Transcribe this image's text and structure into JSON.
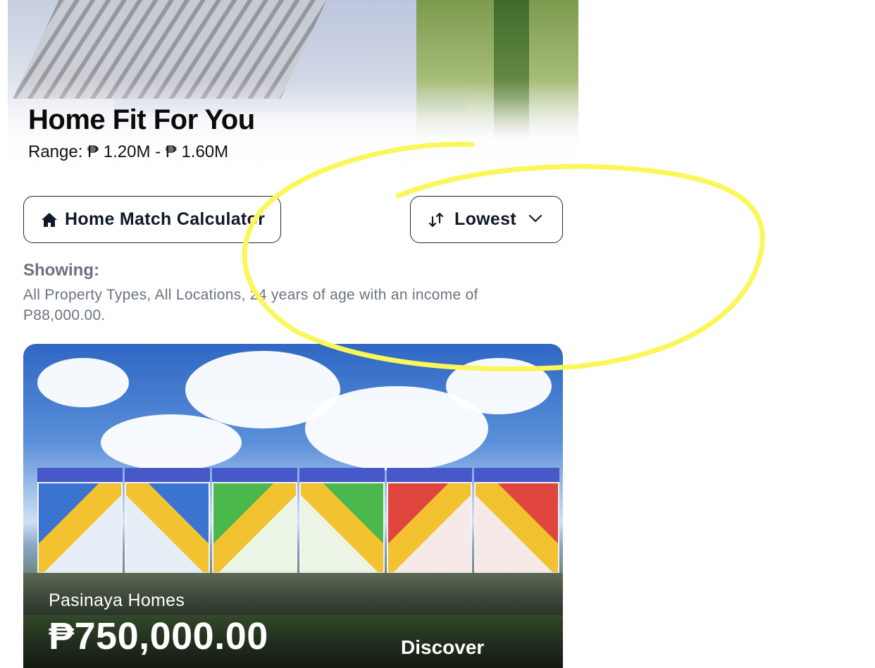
{
  "hero": {
    "title": "Home Fit For You",
    "range": "Range: ₱ 1.20M - ₱ 1.60M"
  },
  "toolbar": {
    "calculator_label": "Home Match Calculator",
    "sort_label": "Lowest",
    "icons": [
      "home-icon",
      "sort-arrows-icon",
      "chevron-down-icon"
    ]
  },
  "filters": {
    "showing_label": "Showing:",
    "showing_text": "All Property Types, All Locations, 24 years of age with an income of P88,000.00."
  },
  "listing": {
    "name": "Pasinaya Homes",
    "price": "₱750,000.00",
    "cta": "Discover"
  },
  "colors": {
    "annotation": "#fbf65a",
    "border": "#1f2937",
    "muted_text": "#6b7280"
  }
}
